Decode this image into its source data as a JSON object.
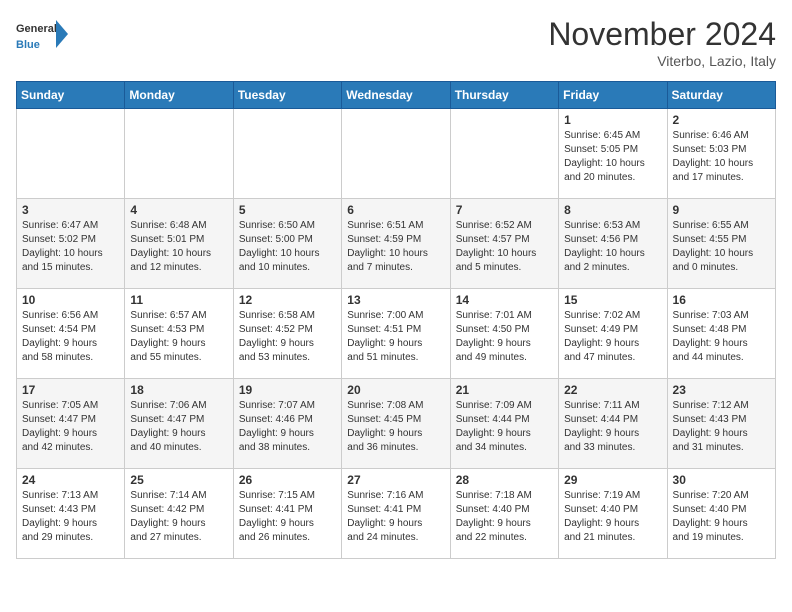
{
  "header": {
    "logo_general": "General",
    "logo_blue": "Blue",
    "month_title": "November 2024",
    "location": "Viterbo, Lazio, Italy"
  },
  "calendar": {
    "days_of_week": [
      "Sunday",
      "Monday",
      "Tuesday",
      "Wednesday",
      "Thursday",
      "Friday",
      "Saturday"
    ],
    "weeks": [
      [
        {
          "day": "",
          "info": ""
        },
        {
          "day": "",
          "info": ""
        },
        {
          "day": "",
          "info": ""
        },
        {
          "day": "",
          "info": ""
        },
        {
          "day": "",
          "info": ""
        },
        {
          "day": "1",
          "info": "Sunrise: 6:45 AM\nSunset: 5:05 PM\nDaylight: 10 hours\nand 20 minutes."
        },
        {
          "day": "2",
          "info": "Sunrise: 6:46 AM\nSunset: 5:03 PM\nDaylight: 10 hours\nand 17 minutes."
        }
      ],
      [
        {
          "day": "3",
          "info": "Sunrise: 6:47 AM\nSunset: 5:02 PM\nDaylight: 10 hours\nand 15 minutes."
        },
        {
          "day": "4",
          "info": "Sunrise: 6:48 AM\nSunset: 5:01 PM\nDaylight: 10 hours\nand 12 minutes."
        },
        {
          "day": "5",
          "info": "Sunrise: 6:50 AM\nSunset: 5:00 PM\nDaylight: 10 hours\nand 10 minutes."
        },
        {
          "day": "6",
          "info": "Sunrise: 6:51 AM\nSunset: 4:59 PM\nDaylight: 10 hours\nand 7 minutes."
        },
        {
          "day": "7",
          "info": "Sunrise: 6:52 AM\nSunset: 4:57 PM\nDaylight: 10 hours\nand 5 minutes."
        },
        {
          "day": "8",
          "info": "Sunrise: 6:53 AM\nSunset: 4:56 PM\nDaylight: 10 hours\nand 2 minutes."
        },
        {
          "day": "9",
          "info": "Sunrise: 6:55 AM\nSunset: 4:55 PM\nDaylight: 10 hours\nand 0 minutes."
        }
      ],
      [
        {
          "day": "10",
          "info": "Sunrise: 6:56 AM\nSunset: 4:54 PM\nDaylight: 9 hours\nand 58 minutes."
        },
        {
          "day": "11",
          "info": "Sunrise: 6:57 AM\nSunset: 4:53 PM\nDaylight: 9 hours\nand 55 minutes."
        },
        {
          "day": "12",
          "info": "Sunrise: 6:58 AM\nSunset: 4:52 PM\nDaylight: 9 hours\nand 53 minutes."
        },
        {
          "day": "13",
          "info": "Sunrise: 7:00 AM\nSunset: 4:51 PM\nDaylight: 9 hours\nand 51 minutes."
        },
        {
          "day": "14",
          "info": "Sunrise: 7:01 AM\nSunset: 4:50 PM\nDaylight: 9 hours\nand 49 minutes."
        },
        {
          "day": "15",
          "info": "Sunrise: 7:02 AM\nSunset: 4:49 PM\nDaylight: 9 hours\nand 47 minutes."
        },
        {
          "day": "16",
          "info": "Sunrise: 7:03 AM\nSunset: 4:48 PM\nDaylight: 9 hours\nand 44 minutes."
        }
      ],
      [
        {
          "day": "17",
          "info": "Sunrise: 7:05 AM\nSunset: 4:47 PM\nDaylight: 9 hours\nand 42 minutes."
        },
        {
          "day": "18",
          "info": "Sunrise: 7:06 AM\nSunset: 4:47 PM\nDaylight: 9 hours\nand 40 minutes."
        },
        {
          "day": "19",
          "info": "Sunrise: 7:07 AM\nSunset: 4:46 PM\nDaylight: 9 hours\nand 38 minutes."
        },
        {
          "day": "20",
          "info": "Sunrise: 7:08 AM\nSunset: 4:45 PM\nDaylight: 9 hours\nand 36 minutes."
        },
        {
          "day": "21",
          "info": "Sunrise: 7:09 AM\nSunset: 4:44 PM\nDaylight: 9 hours\nand 34 minutes."
        },
        {
          "day": "22",
          "info": "Sunrise: 7:11 AM\nSunset: 4:44 PM\nDaylight: 9 hours\nand 33 minutes."
        },
        {
          "day": "23",
          "info": "Sunrise: 7:12 AM\nSunset: 4:43 PM\nDaylight: 9 hours\nand 31 minutes."
        }
      ],
      [
        {
          "day": "24",
          "info": "Sunrise: 7:13 AM\nSunset: 4:43 PM\nDaylight: 9 hours\nand 29 minutes."
        },
        {
          "day": "25",
          "info": "Sunrise: 7:14 AM\nSunset: 4:42 PM\nDaylight: 9 hours\nand 27 minutes."
        },
        {
          "day": "26",
          "info": "Sunrise: 7:15 AM\nSunset: 4:41 PM\nDaylight: 9 hours\nand 26 minutes."
        },
        {
          "day": "27",
          "info": "Sunrise: 7:16 AM\nSunset: 4:41 PM\nDaylight: 9 hours\nand 24 minutes."
        },
        {
          "day": "28",
          "info": "Sunrise: 7:18 AM\nSunset: 4:40 PM\nDaylight: 9 hours\nand 22 minutes."
        },
        {
          "day": "29",
          "info": "Sunrise: 7:19 AM\nSunset: 4:40 PM\nDaylight: 9 hours\nand 21 minutes."
        },
        {
          "day": "30",
          "info": "Sunrise: 7:20 AM\nSunset: 4:40 PM\nDaylight: 9 hours\nand 19 minutes."
        }
      ]
    ]
  }
}
